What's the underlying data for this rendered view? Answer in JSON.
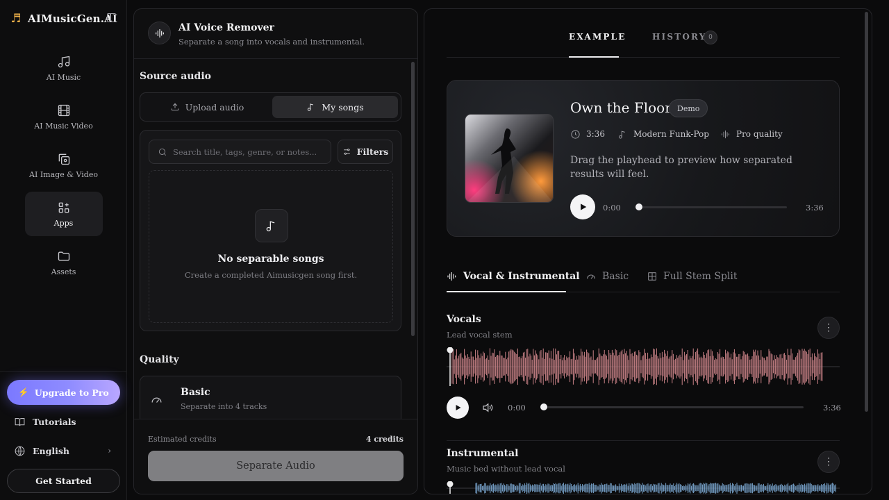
{
  "brand": {
    "name": "AIMusicGen.AI",
    "logo_icon": "music-note-icon"
  },
  "sidebar": {
    "items": [
      {
        "label": "AI Music",
        "icon": "music-icon"
      },
      {
        "label": "AI Music Video",
        "icon": "film-icon"
      },
      {
        "label": "AI Image & Video",
        "icon": "image-copy-icon"
      },
      {
        "label": "Apps",
        "icon": "apps-icon",
        "active": true
      },
      {
        "label": "Assets",
        "icon": "folder-icon"
      }
    ],
    "upgrade_label": "Upgrade to Pro",
    "tutorials_label": "Tutorials",
    "language_label": "English",
    "get_started_label": "Get Started"
  },
  "tool": {
    "title": "AI Voice Remover",
    "subtitle": "Separate a song into vocals and instrumental.",
    "source_label": "Source audio",
    "upload_label": "Upload audio",
    "mysongs_label": "My songs",
    "search_placeholder": "Search title, tags, genre, or notes...",
    "filters_label": "Filters",
    "empty_title": "No separable songs",
    "empty_sub": "Create a completed Aimusicgen song first.",
    "quality_label": "Quality",
    "quality_option_title": "Basic",
    "quality_option_sub": "Separate into 4 tracks",
    "estimated_label": "Estimated credits",
    "estimated_value": "4 credits",
    "separate_label": "Separate Audio"
  },
  "right": {
    "tabs": {
      "example": "EXAMPLE",
      "history": "HISTORY",
      "history_count": "0"
    },
    "track": {
      "title": "Own the Floor",
      "badge": "Demo",
      "duration": "3:36",
      "genre": "Modern Funk-Pop",
      "quality": "Pro quality",
      "description": "Drag the playhead to preview how separated results will feel.",
      "time_current": "0:00",
      "time_total": "3:36"
    },
    "stem_tabs": {
      "vocal_instrumental": "Vocal & Instrumental",
      "basic": "Basic",
      "full_stem_split": "Full Stem Split"
    },
    "stems": [
      {
        "title": "Vocals",
        "subtitle": "Lead vocal stem",
        "time_current": "0:00",
        "time_total": "3:36",
        "color": "#c98287"
      },
      {
        "title": "Instrumental",
        "subtitle": "Music bed without lead vocal",
        "color": "#7aa6cf"
      }
    ]
  }
}
